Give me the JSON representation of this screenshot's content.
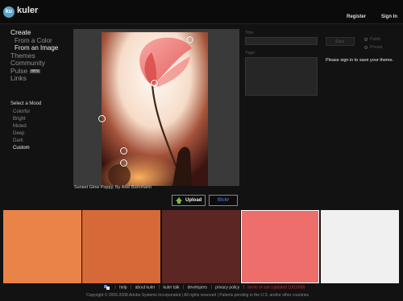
{
  "header": {
    "app_name": "kuler",
    "logo_text": "ku",
    "register_label": "Register",
    "signin_label": "Sign In"
  },
  "sidebar": {
    "create_label": "Create",
    "create_items": [
      "From a Color",
      "From an Image"
    ],
    "main_items": [
      "Themes",
      "Community"
    ],
    "pulse_label": "Pulse",
    "pulse_badge": "BETA",
    "links_label": "Links",
    "mood_title": "Select a Mood",
    "moods": [
      "Colorful",
      "Bright",
      "Muted",
      "Deep",
      "Dark",
      "Custom"
    ],
    "active_mood": "Custom"
  },
  "image": {
    "caption": "Sunset Glow Poppy, By Axel Bührmann"
  },
  "buttons": {
    "upload_label": "Upload",
    "flickr_part1": "flick",
    "flickr_part2": "r"
  },
  "form": {
    "title_label": "Title:",
    "title_value": "",
    "tags_label": "Tags:",
    "tags_value": "",
    "save_label": "Save",
    "public_label": "Public",
    "private_label": "Private",
    "signin_message": "Please sign in to save your theme."
  },
  "swatches": [
    {
      "color": "#ea8347"
    },
    {
      "color": "#d66938"
    },
    {
      "color": "#5c2624"
    },
    {
      "color": "#ee6e6c"
    },
    {
      "color": "#f0f0f0"
    }
  ],
  "footer": {
    "links": [
      "help",
      "about kuler",
      "kuler talk",
      "developers",
      "privacy policy"
    ],
    "terms": "terms of use (updated 10/15/08)",
    "copyright": "Copyright © 2006-2008 Adobe Systems Incorporated | All rights reserved | Patents pending in the U.S. and/or other countries"
  },
  "icons": {
    "logo": "kuler-logo-icon",
    "upload": "upload-arrow-icon",
    "footer": "adobe-icon"
  }
}
